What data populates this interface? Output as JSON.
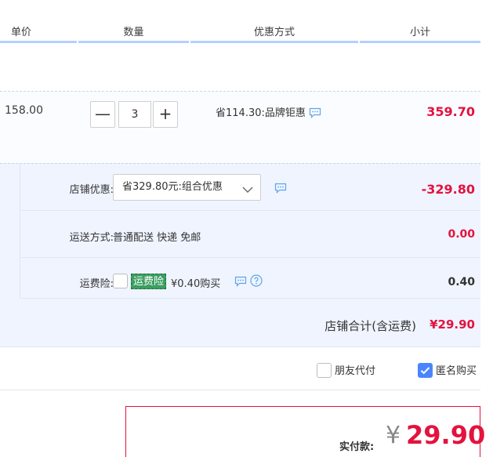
{
  "header": {
    "unit_price": "单价",
    "quantity": "数量",
    "discount_method": "优惠方式",
    "subtotal": "小计"
  },
  "item": {
    "unit_price": "158.00",
    "quantity": "3",
    "minus": "—",
    "plus": "+",
    "discount": "省114.30:品牌钜惠",
    "subtotal": "359.70"
  },
  "store": {
    "discount_label": "店铺优惠:",
    "discount_select": "省329.80元:组合优惠",
    "discount_value": "-329.80",
    "shipping_label": "运送方式:",
    "shipping_text": "普通配送 快递 免邮",
    "shipping_value": "0.00",
    "insurance_label": "运费险:",
    "insurance_tag": "运费险",
    "insurance_price": "¥0.40购买",
    "insurance_value": "0.40",
    "total_label": "店铺合计(含运费)",
    "total_value": "¥29.90"
  },
  "options": {
    "friend_pay": "朋友代付",
    "friend_pay_checked": false,
    "anonymous": "匿名购买",
    "anonymous_checked": true
  },
  "payment": {
    "label": "实付款:",
    "currency": "¥",
    "amount": "29.90"
  },
  "colors": {
    "price_red": "#e4123e",
    "header_underline": "#b2d1ff",
    "store_bg": "#eff4ff",
    "insurance_green": "#3a9e60",
    "checkbox_blue": "#4a85ff"
  },
  "icons": {
    "chat": "chat-bubble-icon",
    "help": "question-circle-icon",
    "chevron": "chevron-down-icon",
    "check": "checkmark-icon"
  }
}
